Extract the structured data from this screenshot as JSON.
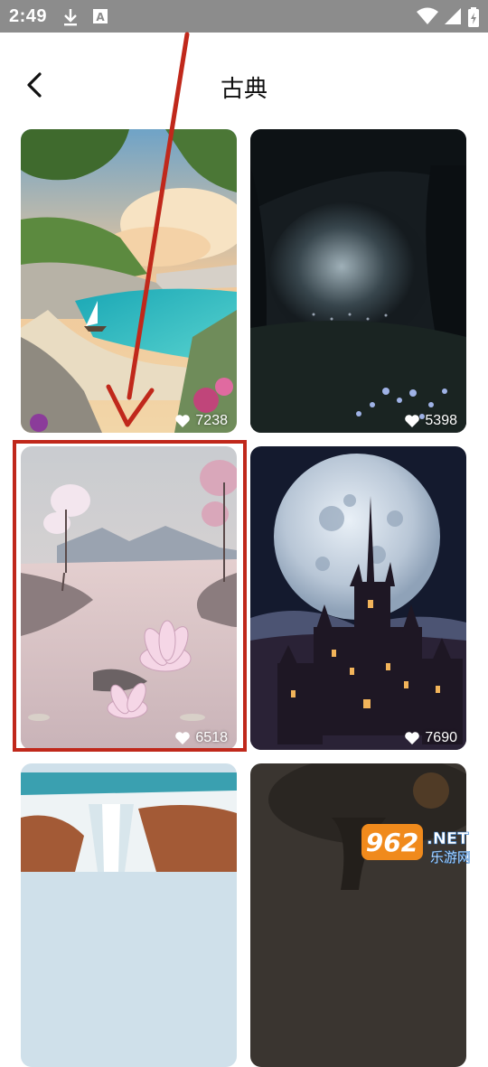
{
  "status_bar": {
    "time": "2:49"
  },
  "header": {
    "title": "古典"
  },
  "cards": [
    {
      "likes": "7238"
    },
    {
      "likes": "5398"
    },
    {
      "likes": "6518"
    },
    {
      "likes": "7690"
    },
    {
      "likes": ""
    },
    {
      "likes": ""
    }
  ],
  "watermark": {
    "number": "962",
    "suffix": ".NET",
    "subtitle": "乐游网"
  },
  "colors": {
    "highlight": "#c0281b",
    "status_bar": "#8c8c8c"
  }
}
